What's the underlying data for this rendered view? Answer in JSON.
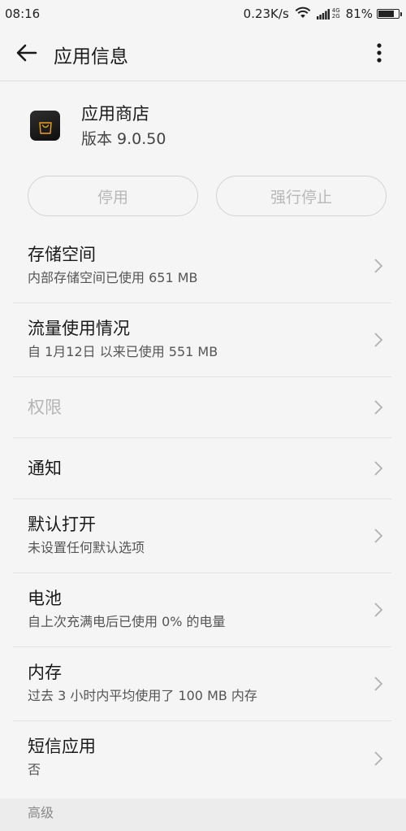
{
  "status_bar": {
    "time": "08:16",
    "speed": "0.23K/s",
    "net_top": "4G",
    "net_bottom": "2G",
    "battery": "81%",
    "battery_level": 0.81,
    "icons": [
      "wifi-icon",
      "signal-icon",
      "battery-icon"
    ]
  },
  "app_bar": {
    "back_icon": "back-arrow-icon",
    "title": "应用信息",
    "more_icon": "more-vertical-icon"
  },
  "app": {
    "name": "应用商店",
    "version": "版本 9.0.50",
    "icon": "shopping-bag-icon"
  },
  "buttons": {
    "disable": "停用",
    "force_stop": "强行停止"
  },
  "settings": [
    {
      "title": "存储空间",
      "subtitle": "内部存储空间已使用 651 MB"
    },
    {
      "title": "流量使用情况",
      "subtitle": "自 1月12日 以来已使用 551 MB"
    },
    {
      "title": "权限"
    },
    {
      "title": "通知"
    },
    {
      "title": "默认打开",
      "subtitle": "未设置任何默认选项"
    },
    {
      "title": "电池",
      "subtitle": "自上次充满电后已使用 0% 的电量"
    },
    {
      "title": "内存",
      "subtitle": "过去 3 小时内平均使用了 100 MB 内存"
    },
    {
      "title": "短信应用",
      "subtitle": "否"
    }
  ],
  "section": {
    "advanced": "高级"
  },
  "colors": {
    "background": "#f5f5f5",
    "text_primary": "#1a1a1a",
    "text_secondary": "#555555",
    "text_disabled": "#b5b5b5",
    "divider": "#e3e3e3",
    "app_icon_bg": "#1a1a1a",
    "app_icon_accent": "#f0a020"
  }
}
